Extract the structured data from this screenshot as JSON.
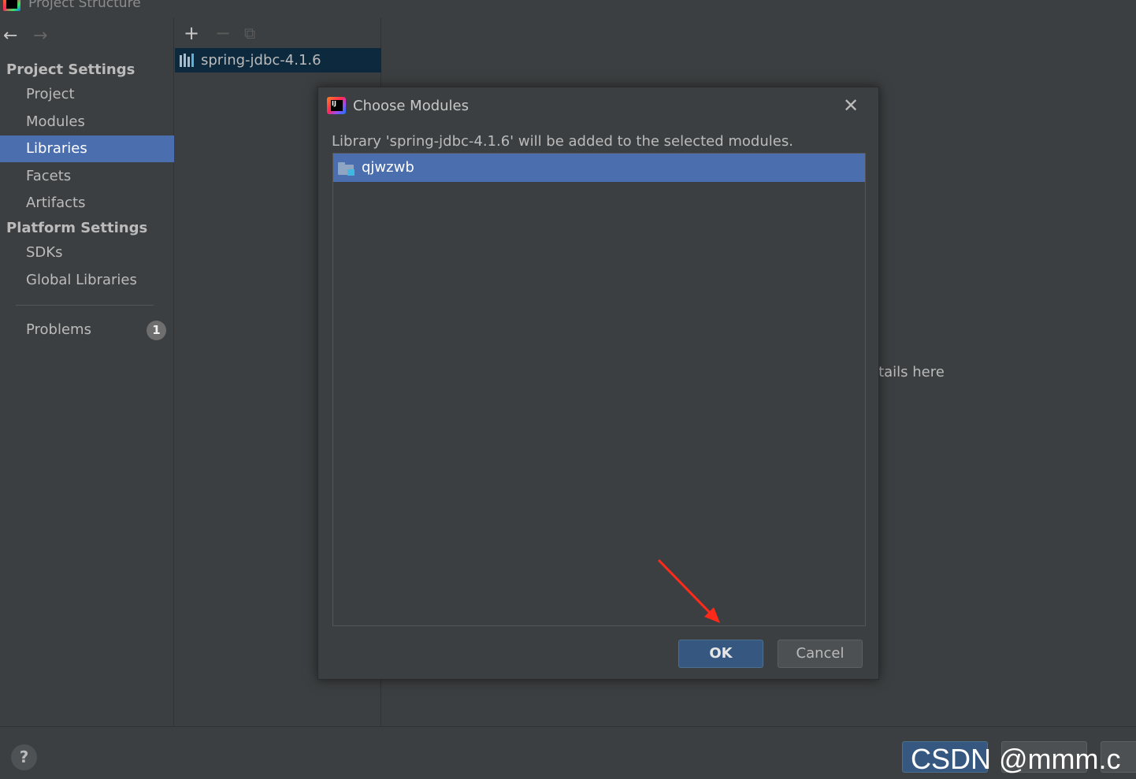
{
  "window": {
    "title": "Project Structure"
  },
  "sidebar": {
    "project_settings_header": "Project Settings",
    "platform_settings_header": "Platform Settings",
    "items": [
      {
        "label": "Project"
      },
      {
        "label": "Modules"
      },
      {
        "label": "Libraries"
      },
      {
        "label": "Facets"
      },
      {
        "label": "Artifacts"
      },
      {
        "label": "SDKs"
      },
      {
        "label": "Global Libraries"
      },
      {
        "label": "Problems"
      }
    ],
    "problems_count": "1",
    "selected": "Libraries"
  },
  "libraries_panel": {
    "library_name": "spring-jdbc-4.1.6"
  },
  "details": {
    "hint": "etails here"
  },
  "dialog": {
    "title": "Choose Modules",
    "message": "Library 'spring-jdbc-4.1.6' will be added to the selected modules.",
    "modules": [
      "qjwzwb"
    ],
    "ok_label": "OK",
    "cancel_label": "Cancel"
  },
  "bottom": {
    "help": "?"
  },
  "watermark": "CSDN @mmm.c",
  "colors": {
    "background": "#3c3f41",
    "selection": "#4b6eaf",
    "library_row": "#0d293e",
    "ok_button": "#365880",
    "arrow": "#ff2a1a"
  },
  "icons": {
    "back": "arrow-left-icon",
    "forward": "arrow-right-icon",
    "add": "plus-icon",
    "remove": "minus-icon",
    "copy": "copy-icon",
    "library": "library-icon",
    "module": "module-folder-icon",
    "close": "close-icon"
  }
}
